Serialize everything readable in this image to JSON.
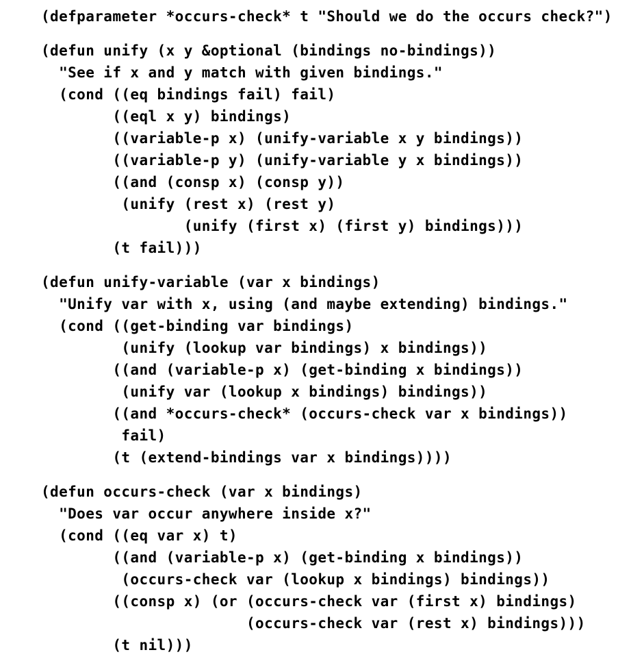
{
  "code": {
    "lines": [
      "(defparameter *occurs-check* t \"Should we do the occurs check?\")",
      "(defun unify (x y &optional (bindings no-bindings))",
      "  \"See if x and y match with given bindings.\"",
      "  (cond ((eq bindings fail) fail)",
      "        ((eql x y) bindings)",
      "        ((variable-p x) (unify-variable x y bindings))",
      "        ((variable-p y) (unify-variable y x bindings))",
      "        ((and (consp x) (consp y))",
      "         (unify (rest x) (rest y)",
      "                (unify (first x) (first y) bindings)))",
      "        (t fail)))",
      "(defun unify-variable (var x bindings)",
      "  \"Unify var with x, using (and maybe extending) bindings.\"",
      "  (cond ((get-binding var bindings)",
      "         (unify (lookup var bindings) x bindings))",
      "        ((and (variable-p x) (get-binding x bindings))",
      "         (unify var (lookup x bindings) bindings))",
      "        ((and *occurs-check* (occurs-check var x bindings))",
      "         fail)",
      "        (t (extend-bindings var x bindings))))",
      "(defun occurs-check (var x bindings)",
      "  \"Does var occur anywhere inside x?\"",
      "  (cond ((eq var x) t)",
      "        ((and (variable-p x) (get-binding x bindings))",
      "         (occurs-check var (lookup x bindings) bindings))",
      "        ((consp x) (or (occurs-check var (first x) bindings)",
      "                       (occurs-check var (rest x) bindings)))",
      "        (t nil)))"
    ]
  }
}
